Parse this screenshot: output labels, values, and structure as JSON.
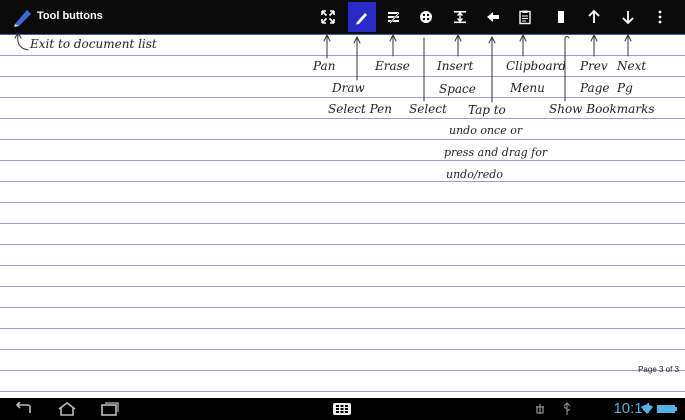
{
  "app": {
    "title": "Tool buttons"
  },
  "toolbar": {
    "buttons": [
      {
        "name": "pan",
        "icon": "pan-icon"
      },
      {
        "name": "draw",
        "icon": "pen-icon",
        "active": true
      },
      {
        "name": "erase",
        "icon": "eraser-icon"
      },
      {
        "name": "select-pen",
        "icon": "select-pen-icon"
      },
      {
        "name": "insert-space",
        "icon": "insert-space-icon"
      },
      {
        "name": "undo",
        "icon": "undo-arrow-icon"
      },
      {
        "name": "clipboard",
        "icon": "clipboard-icon"
      },
      {
        "name": "bookmark",
        "icon": "bookmark-icon"
      },
      {
        "name": "prev-page",
        "icon": "up-arrow-icon"
      },
      {
        "name": "next-page",
        "icon": "down-arrow-icon"
      },
      {
        "name": "overflow",
        "icon": "overflow-menu-icon"
      }
    ],
    "active_color": "#2a2ac8"
  },
  "annotations": {
    "exit": "Exit to document list",
    "pan": "Pan",
    "draw": "Draw",
    "erase": "Erase",
    "select_pen": "Select Pen",
    "select": "Select",
    "insert": "Insert",
    "space": "Space",
    "tap": "Tap to",
    "undo_line1": "undo once or",
    "undo_line2": "press and drag for",
    "undo_line3": "undo/redo",
    "clipboard": "Clipboard",
    "menu": "Menu",
    "show_bookmarks": "Show Bookmarks",
    "prev": "Prev",
    "page": "Page",
    "next": "Next",
    "pg": "Pg"
  },
  "page_indicator": "Page 3 of 3",
  "status": {
    "clock": "10:14"
  },
  "colors": {
    "rule": "#9aa3c8",
    "clock": "#4fb3e8"
  }
}
